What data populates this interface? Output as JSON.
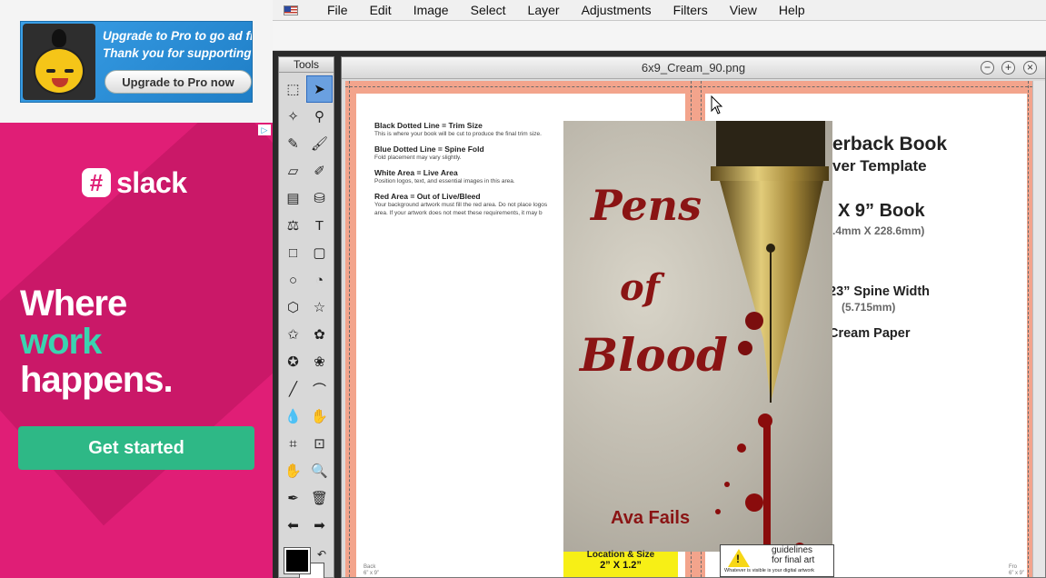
{
  "ads": {
    "sumo": {
      "line1": "Upgrade to Pro to go ad free.",
      "line2": "Thank you for supporting Sumo!",
      "button": "Upgrade to Pro now"
    },
    "slack": {
      "adchoice": "▷",
      "logo": "slack",
      "line1": "Where",
      "line2": "work",
      "line3": "happens.",
      "cta": "Get started"
    }
  },
  "menubar": {
    "items": [
      "File",
      "Edit",
      "Image",
      "Select",
      "Layer",
      "Adjustments",
      "Filters",
      "View",
      "Help"
    ]
  },
  "tools": {
    "title": "Tools",
    "items": [
      {
        "name": "rect-select-tool-icon",
        "glyph": "⬚"
      },
      {
        "name": "move-tool-icon",
        "glyph": "➤",
        "active": true
      },
      {
        "name": "magic-wand-tool-icon",
        "glyph": "✧"
      },
      {
        "name": "lasso-tool-icon",
        "glyph": "⚲"
      },
      {
        "name": "pencil-tool-icon",
        "glyph": "✎"
      },
      {
        "name": "brush-tool-icon",
        "glyph": "🖌"
      },
      {
        "name": "eraser-tool-icon",
        "glyph": "▱"
      },
      {
        "name": "clone-tool-icon",
        "glyph": "✐"
      },
      {
        "name": "gradient-tool-icon",
        "glyph": "▤"
      },
      {
        "name": "bucket-tool-icon",
        "glyph": "⛁"
      },
      {
        "name": "stamp-tool-icon",
        "glyph": "⚖"
      },
      {
        "name": "text-tool-icon",
        "glyph": "T"
      },
      {
        "name": "rectangle-shape-icon",
        "glyph": "□"
      },
      {
        "name": "rounded-rect-shape-icon",
        "glyph": "▢"
      },
      {
        "name": "ellipse-shape-icon",
        "glyph": "○"
      },
      {
        "name": "pie-shape-icon",
        "glyph": "◔"
      },
      {
        "name": "hexagon-shape-icon",
        "glyph": "⬡"
      },
      {
        "name": "star-shape-icon",
        "glyph": "☆"
      },
      {
        "name": "star5-shape-icon",
        "glyph": "✩"
      },
      {
        "name": "cog-shape-icon",
        "glyph": "✿"
      },
      {
        "name": "badge-shape-icon",
        "glyph": "✪"
      },
      {
        "name": "flower-shape-icon",
        "glyph": "❀"
      },
      {
        "name": "line-tool-icon",
        "glyph": "╱"
      },
      {
        "name": "curve-tool-icon",
        "glyph": "⌒"
      },
      {
        "name": "drop-tool-icon",
        "glyph": "💧"
      },
      {
        "name": "smudge-tool-icon",
        "glyph": "✋"
      },
      {
        "name": "crop-tool-icon",
        "glyph": "⌗"
      },
      {
        "name": "transform-tool-icon",
        "glyph": "⊡"
      },
      {
        "name": "hand-tool-icon",
        "glyph": "✋"
      },
      {
        "name": "zoom-tool-icon",
        "glyph": "🔍"
      },
      {
        "name": "eyedropper-tool-icon",
        "glyph": "✒"
      },
      {
        "name": "trash-tool-icon",
        "glyph": "🗑"
      },
      {
        "name": "arrow-left-icon",
        "glyph": "⬅"
      },
      {
        "name": "arrow-right-icon",
        "glyph": "➡"
      }
    ],
    "swap_glyph": "↶"
  },
  "document": {
    "title": "6x9_Cream_90.png",
    "buttons": {
      "min": "−",
      "max": "+",
      "close": "×"
    },
    "legend": [
      {
        "heading": "Black Dotted Line = Trim Size",
        "text": "This is where your book will be cut to produce the final trim size."
      },
      {
        "heading": "Blue Dotted Line = Spine Fold",
        "text": "Fold placement may vary slightly."
      },
      {
        "heading": "White Area = Live Area",
        "text": "Position logos, text, and essential images in this area."
      },
      {
        "heading": "Red Area = Out of Live/Bleed",
        "text": "Your background artwork must fill the red area. Do not place logos"
      },
      {
        "heading": "",
        "text": "area. If your artwork does not meet these requirements, it may b"
      }
    ],
    "cover": {
      "title_line1": "Pens",
      "title_line2": "of",
      "title_line3": "Blood",
      "author": "Ava Fails"
    },
    "template": {
      "line1": "erback Book",
      "line2": "ver Template",
      "size_main": "X 9” Book",
      "size_mm": ".4mm X 228.6mm)",
      "spine_main": "23” Spine Width",
      "spine_mm": "(5.715mm)",
      "paper": "Cream Paper"
    },
    "barcode": {
      "line1": "Location & Size",
      "line2": "2” X 1.2”"
    },
    "warning": {
      "line1": "guidelines",
      "line2": "for final art",
      "line3": "Whatever is visible is your digital artwork"
    },
    "corner_left_1": "Back",
    "corner_left_2": "6” x 9”",
    "corner_right_1": "Fro",
    "corner_right_2": "6” x 9”"
  }
}
